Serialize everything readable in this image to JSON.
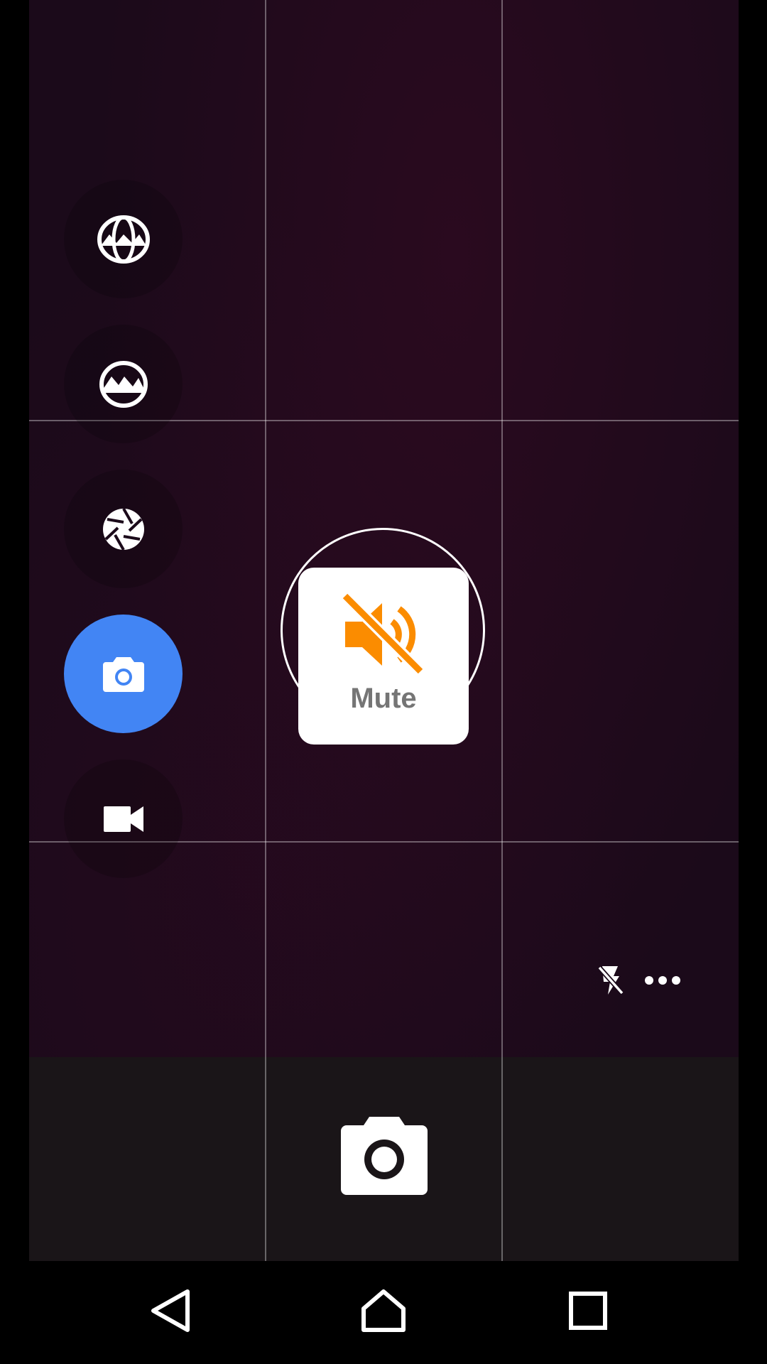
{
  "app": {
    "name": "Camera"
  },
  "modes": [
    {
      "id": "photosphere",
      "icon": "photosphere-icon",
      "active": false
    },
    {
      "id": "panorama",
      "icon": "panorama-icon",
      "active": false
    },
    {
      "id": "lens-blur",
      "icon": "aperture-icon",
      "active": false
    },
    {
      "id": "camera",
      "icon": "camera-icon",
      "active": true
    },
    {
      "id": "video",
      "icon": "video-icon",
      "active": false
    }
  ],
  "toast": {
    "label": "Mute",
    "icon": "volume-off-icon",
    "icon_color": "#FB8C00"
  },
  "controls": {
    "flash_icon": "flash-off-icon",
    "more_icon": "more-horiz-icon"
  },
  "shutter": {
    "icon": "camera-shutter-icon"
  },
  "nav": {
    "back_icon": "back-triangle-icon",
    "home_icon": "home-icon",
    "recents_icon": "recents-square-icon"
  },
  "colors": {
    "accent": "#4285F4",
    "mute_orange": "#FB8C00"
  }
}
